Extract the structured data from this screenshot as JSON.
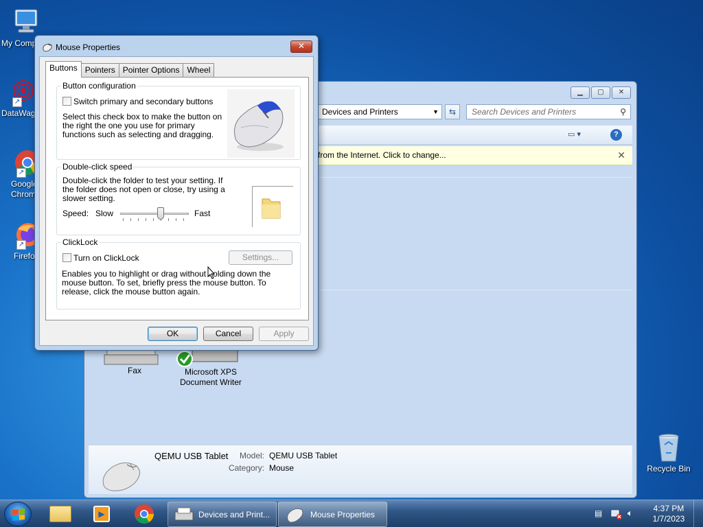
{
  "desktop": {
    "icons": [
      {
        "label": "My Computer",
        "icon": "computer-icon"
      },
      {
        "label": "DataWagon",
        "icon": "datawagon-icon"
      },
      {
        "label": "Google Chrome",
        "icon": "chrome-icon"
      },
      {
        "label": "Firefox",
        "icon": "firefox-icon"
      },
      {
        "label": "Recycle Bin",
        "icon": "recycle-bin-icon"
      }
    ]
  },
  "explorer": {
    "address": "Devices and Printers",
    "search_placeholder": "Search Devices and Printers",
    "infobar": "from the Internet. Click to change...",
    "devices": [
      {
        "label": "Fax"
      },
      {
        "label": "Microsoft XPS Document Writer"
      }
    ],
    "details": {
      "name": "QEMU USB Tablet",
      "model_label": "Model:",
      "model_value": "QEMU USB Tablet",
      "category_label": "Category:",
      "category_value": "Mouse"
    }
  },
  "dialog": {
    "title": "Mouse Properties",
    "close_glyph": "✕",
    "tabs": [
      "Buttons",
      "Pointers",
      "Pointer Options",
      "Wheel"
    ],
    "active_tab": "Buttons",
    "button_config": {
      "label": "Button configuration",
      "checkbox_label": "Switch primary and secondary buttons",
      "checked": false,
      "description": "Select this check box to make the button on the right the one you use for primary functions such as selecting and dragging."
    },
    "double_click": {
      "label": "Double-click speed",
      "description": "Double-click the folder to test your setting. If the folder does not open or close, try using a slower setting.",
      "speed_label": "Speed:",
      "slow_label": "Slow",
      "fast_label": "Fast",
      "speed_fraction": 0.6
    },
    "clicklock": {
      "label": "ClickLock",
      "checkbox_label": "Turn on ClickLock",
      "checked": false,
      "settings_label": "Settings...",
      "description": "Enables you to highlight or drag without holding down the mouse button. To set, briefly press the mouse button. To release, click the mouse button again."
    },
    "buttons": {
      "ok": "OK",
      "cancel": "Cancel",
      "apply": "Apply"
    }
  },
  "taskbar": {
    "items": [
      {
        "label": "Devices and Print...",
        "icon": "devices-printers-icon"
      },
      {
        "label": "Mouse Properties",
        "icon": "mouse-icon"
      }
    ],
    "time": "4:37 PM",
    "date": "1/7/2023"
  }
}
